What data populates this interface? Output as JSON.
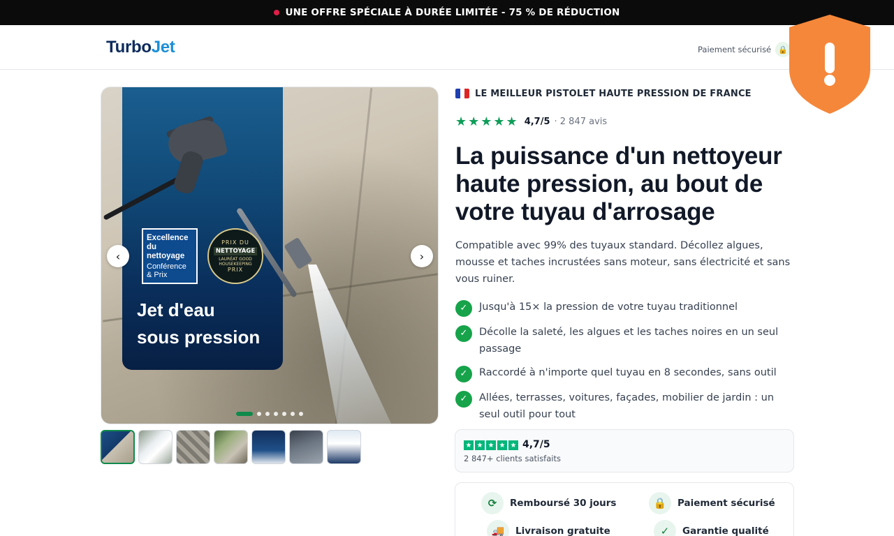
{
  "promo": {
    "text": "UNE OFFRE SPÉCIALE À DURÉE LIMITÉE - 75 % DE RÉDUCTION",
    "dot_color": "#e11d48"
  },
  "header": {
    "logo_part1": "Turbo",
    "logo_part2": "Jet",
    "secure_label": "Paiement sécurisé",
    "lock_icon": "🔒"
  },
  "alert_shield": {
    "glyph": "!",
    "color": "#f5873a"
  },
  "gallery": {
    "prev_arrow": "‹",
    "next_arrow": "›",
    "badge1_line1": "Excellence du nettoyage",
    "badge1_line2": "Conférence & Prix",
    "badge2_line1": "PRIX DU",
    "badge2_line2": "NETTOYAGE",
    "badge2_line3": "LAURÉAT GOOD HOUSEKEEPING",
    "badge2_line4": "PRIX",
    "panel_title_1": "Jet d'eau",
    "panel_title_2": "sous pression",
    "dot_count": 7,
    "active_dot": 0,
    "thumb_count": 7
  },
  "product": {
    "eyebrow": "LE MEILLEUR PISTOLET HAUTE PRESSION DE FRANCE",
    "stars": "★★★★★",
    "rating": "4,7/5",
    "reviews": "· 2 847 avis",
    "headline": "La puissance d'un nettoyeur haute pression, au bout de votre tuyau d'arrosage",
    "subcopy": "Compatible avec 99% des tuyaux standard. Décollez algues, mousse et taches incrustées sans moteur, sans électricité et sans vous ruiner.",
    "benefits": [
      "Jusqu'à 15× la pression de votre tuyau traditionnel",
      "Décolle la saleté, les algues et les taches noires en un seul passage",
      "Raccordé à n'importe quel tuyau en 8 secondes, sans outil",
      "Allées, terrasses, voitures, façades, mobilier de jardin : un seul outil pour tout"
    ],
    "check_glyph": "✓"
  },
  "trust": {
    "score": "4,7/5",
    "count": "2 847+ clients satisfaits",
    "star_glyph": "★"
  },
  "guarantees": [
    {
      "icon": "⟳",
      "label": "Remboursé 30 jours"
    },
    {
      "icon": "🔒",
      "label": "Paiement sécurisé"
    },
    {
      "icon": "🚚",
      "label": "Livraison gratuite"
    },
    {
      "icon": "✓",
      "label": "Garantie qualité"
    }
  ],
  "colors": {
    "brand_navy": "#0d2b5c",
    "brand_blue": "#1d8fd6",
    "accent_green": "#16a34a",
    "trustpilot_green": "#00b67a"
  }
}
